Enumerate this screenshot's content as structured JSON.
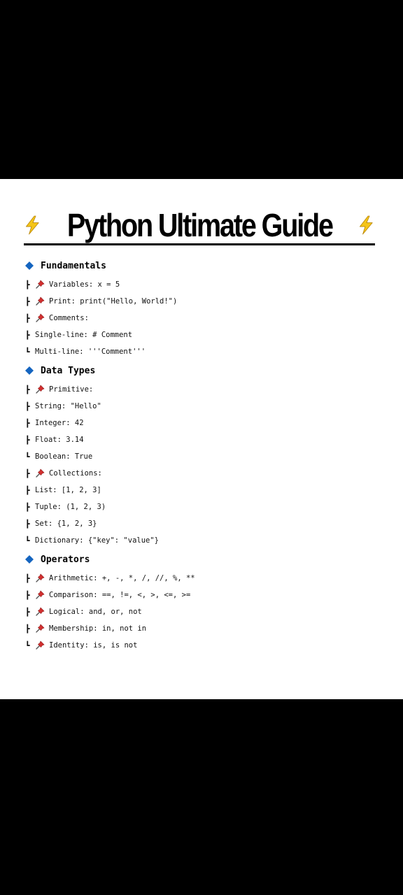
{
  "title": "Python Ultimate Guide",
  "colors": {
    "background_outer": "#000000",
    "sheet": "#ffffff",
    "bolt_fill": "#f5c518",
    "diamond_fill": "#1565c0",
    "pin_fill": "#d32f2f"
  },
  "icons": {
    "title_left": "lightning-icon",
    "title_right": "lightning-icon",
    "section": "blue-diamond-icon",
    "item": "pushpin-icon"
  },
  "sections": [
    {
      "title": "Fundamentals",
      "lines": [
        {
          "branch": "┣",
          "pin": true,
          "text": "Variables: x = 5"
        },
        {
          "branch": "┣",
          "pin": true,
          "text": "Print: print(\"Hello, World!\")"
        },
        {
          "branch": "┣",
          "pin": true,
          "text": "Comments:"
        },
        {
          "branch": "┣",
          "pin": false,
          "text": "Single-line: # Comment"
        },
        {
          "branch": "┗",
          "pin": false,
          "text": "Multi-line: '''Comment'''"
        }
      ]
    },
    {
      "title": "Data Types",
      "lines": [
        {
          "branch": "┣",
          "pin": true,
          "text": "Primitive:"
        },
        {
          "branch": "┣",
          "pin": false,
          "text": "String: \"Hello\""
        },
        {
          "branch": "┣",
          "pin": false,
          "text": "Integer: 42"
        },
        {
          "branch": "┣",
          "pin": false,
          "text": "Float: 3.14"
        },
        {
          "branch": "┗",
          "pin": false,
          "text": "Boolean: True"
        },
        {
          "branch": "┣",
          "pin": true,
          "text": "Collections:"
        },
        {
          "branch": "┣",
          "pin": false,
          "text": "List: [1, 2, 3]"
        },
        {
          "branch": "┣",
          "pin": false,
          "text": "Tuple: (1, 2, 3)"
        },
        {
          "branch": "┣",
          "pin": false,
          "text": "Set: {1, 2, 3}"
        },
        {
          "branch": "┗",
          "pin": false,
          "text": "Dictionary: {\"key\": \"value\"}"
        }
      ]
    },
    {
      "title": "Operators",
      "lines": [
        {
          "branch": "┣",
          "pin": true,
          "text": "Arithmetic: +, -, *, /, //, %, **"
        },
        {
          "branch": "┣",
          "pin": true,
          "text": "Comparison: ==, !=, <, >, <=, >="
        },
        {
          "branch": "┣",
          "pin": true,
          "text": "Logical: and, or, not"
        },
        {
          "branch": "┣",
          "pin": true,
          "text": "Membership: in, not in"
        },
        {
          "branch": "┗",
          "pin": true,
          "text": "Identity: is, is not"
        }
      ]
    }
  ]
}
